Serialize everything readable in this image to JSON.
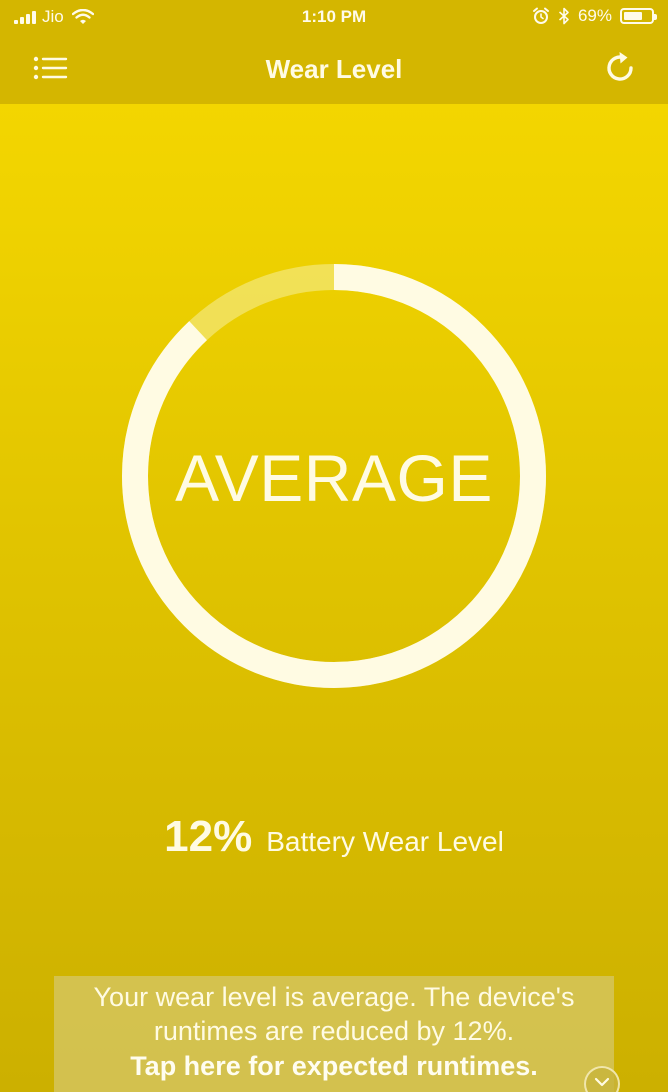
{
  "status_bar": {
    "carrier": "Jio",
    "time": "1:10 PM",
    "battery_percent": "69%",
    "battery_level": 0.69,
    "icons": [
      "signal-icon",
      "wifi-icon",
      "alarm-icon",
      "bluetooth-icon",
      "battery-icon"
    ]
  },
  "nav": {
    "title": "Wear Level",
    "left_icon": "list-menu-icon",
    "right_icon": "refresh-icon"
  },
  "gauge": {
    "label": "AVERAGE",
    "wear_fraction": 0.12,
    "ring_color": "#fffbe3",
    "track_color": "#f3e87a"
  },
  "wear": {
    "value": "12%",
    "caption": "Battery Wear Level"
  },
  "info": {
    "line1": "Your wear level is average. The device's",
    "line2": "runtimes are reduced by 12%.",
    "cta": "Tap here for expected runtimes."
  },
  "colors": {
    "background_top": "#f7d900",
    "background_bottom": "#ccb000",
    "header": "#d4b600",
    "text": "#fffbe3"
  }
}
